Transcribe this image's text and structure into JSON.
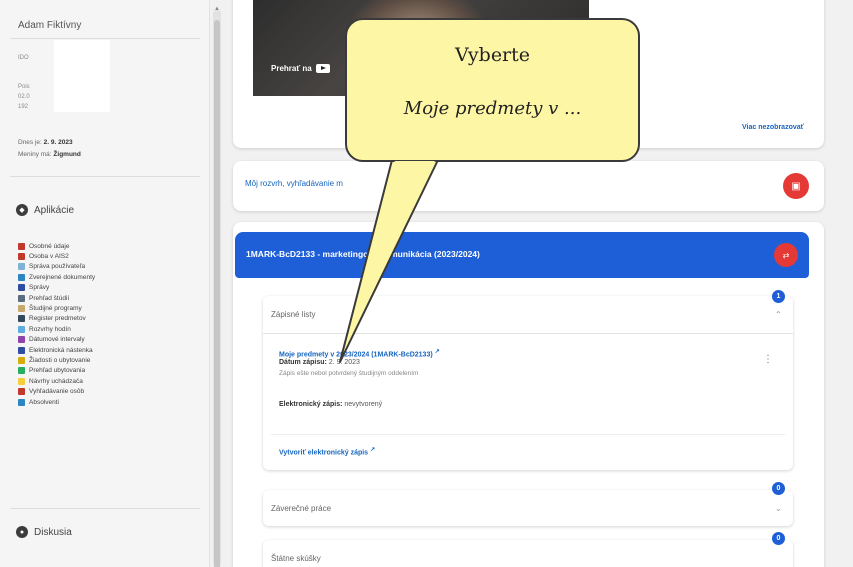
{
  "sidebar": {
    "user_name": "Adam Fiktívny",
    "tiny_lines": [
      "IDO",
      "Pois",
      "02.0",
      "192"
    ],
    "since_label": "Dnes je:",
    "since_value": "2. 9. 2023",
    "name_day_label": "Meniny má:",
    "name_day_value": "Žigmund",
    "apps_heading": "Aplikácie",
    "apps": [
      {
        "label": "Osobné údaje",
        "icon": "person-icon",
        "color": "#c0392b"
      },
      {
        "label": "Osoba v AIS2",
        "icon": "person-icon",
        "color": "#c0392b"
      },
      {
        "label": "Správa používateľa",
        "icon": "users-icon",
        "color": "#7fb3d5"
      },
      {
        "label": "Zverejnené dokumenty",
        "icon": "document-icon",
        "color": "#2e86c1"
      },
      {
        "label": "Správy",
        "icon": "mail-icon",
        "color": "#2e4fa1"
      },
      {
        "label": "Prehľad štúdií",
        "icon": "book-icon",
        "color": "#5d6d7e"
      },
      {
        "label": "Študijné programy",
        "icon": "program-icon",
        "color": "#c8a86b"
      },
      {
        "label": "Register predmetov",
        "icon": "register-icon",
        "color": "#34495e"
      },
      {
        "label": "Rozvrhy hodín",
        "icon": "calendar-icon",
        "color": "#5dade2"
      },
      {
        "label": "Dátumové intervaly",
        "icon": "interval-icon",
        "color": "#8e44ad"
      },
      {
        "label": "Elektronická nástenka",
        "icon": "board-icon",
        "color": "#2e4fa1"
      },
      {
        "label": "Žiadosti o ubytovanie",
        "icon": "request-icon",
        "color": "#d4ac0d"
      },
      {
        "label": "Prehľad ubytovania",
        "icon": "list-icon",
        "color": "#27ae60"
      },
      {
        "label": "Návrhy uchádzača",
        "icon": "proposal-icon",
        "color": "#f4d03f"
      },
      {
        "label": "Vyhľadávanie osôb",
        "icon": "search-person-icon",
        "color": "#c0392b"
      },
      {
        "label": "Absolventi",
        "icon": "graduate-icon",
        "color": "#2e86c1"
      }
    ],
    "discussion_heading": "Diskusia"
  },
  "video": {
    "play_label": "Prehrať na",
    "more_label": "Viac nezobrazovať"
  },
  "schedule": {
    "label": "Môj rozvrh, vyhľadávanie m"
  },
  "course": {
    "title": "1MARK-BcD2133 - marketingová komunikácia (2023/2024)"
  },
  "zapisne": {
    "title": "Zápisné listy",
    "badge": "1",
    "link": "Moje predmety v 2023/2024 (1MARK-BcD2133)",
    "date_label": "Dátum zápisu:",
    "date_value": "2. 9. 2023",
    "note": "Zápis ešte nebol potvrdený študijným oddelením",
    "elec_label": "Elektronický zápis:",
    "elec_value": "nevytvorený",
    "create_link": "Vytvoriť elektronický zápis"
  },
  "zaverecne": {
    "title": "Záverečné práce",
    "badge": "0"
  },
  "statne": {
    "title": "Štátne skúšky",
    "badge": "0"
  },
  "callout": {
    "line1": "Vyberte",
    "line2": "Moje predmety v ..."
  }
}
